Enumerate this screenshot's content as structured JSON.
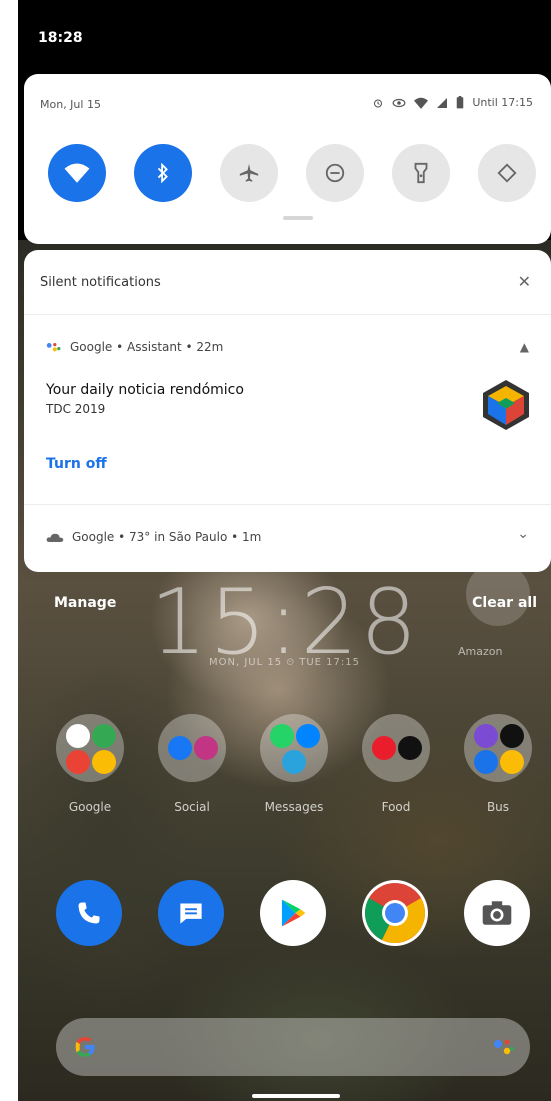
{
  "status_bar": {
    "time": "18:28"
  },
  "quick_settings": {
    "date": "Mon, Jul 15",
    "battery_text": "Until 17:15",
    "tiles": [
      {
        "name": "wifi",
        "state": "on"
      },
      {
        "name": "bluetooth",
        "state": "on"
      },
      {
        "name": "airplane-mode",
        "state": "off"
      },
      {
        "name": "do-not-disturb",
        "state": "off"
      },
      {
        "name": "flashlight",
        "state": "off"
      },
      {
        "name": "auto-rotate",
        "state": "off"
      }
    ],
    "colors": {
      "on": "#1a73e8",
      "off": "#e6e6e6"
    }
  },
  "notifications": {
    "section_title": "Silent notifications",
    "google_assistant": {
      "header": "Google • Assistant • 22m",
      "title": "Your daily noticia rendómico",
      "subtitle": "TDC 2019",
      "action": "Turn off"
    },
    "weather": {
      "header": "Google • 73° in São Paulo • 1m"
    }
  },
  "actions": {
    "manage": "Manage",
    "clear_all": "Clear all"
  },
  "home": {
    "clock": "15:28",
    "clock_date": "MON, JUL 15  ⏲  TUE 17:15",
    "amazon_label": "Amazon",
    "folders": [
      {
        "label": "Google"
      },
      {
        "label": "Social"
      },
      {
        "label": "Messages"
      },
      {
        "label": "Food"
      },
      {
        "label": "Bus"
      }
    ],
    "dock": [
      {
        "name": "phone"
      },
      {
        "name": "messages"
      },
      {
        "name": "play-store"
      },
      {
        "name": "chrome"
      },
      {
        "name": "camera"
      }
    ]
  }
}
